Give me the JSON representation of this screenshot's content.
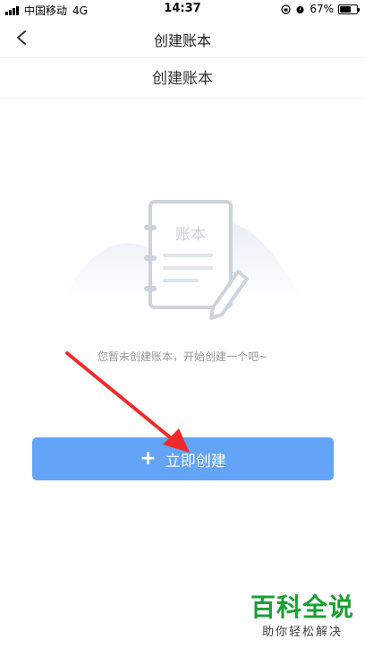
{
  "status_bar": {
    "carrier": "中国移动",
    "network": "4G",
    "time": "14:37",
    "battery": "67%",
    "battery_level": 0.67
  },
  "nav": {
    "title": "创建账本",
    "back_icon": "chevron-left-icon"
  },
  "page": {
    "subtitle": "创建账本",
    "illustration_label": "账本",
    "empty_text": "您暂未创建账本，开始创建一个吧~",
    "create_button_label": "立即创建"
  },
  "watermark": {
    "main": "百科全说",
    "sub": "助你轻松解决"
  },
  "colors": {
    "button": "#63a3f8",
    "arrow": "#f02a2a",
    "watermark": "#1aa035"
  }
}
